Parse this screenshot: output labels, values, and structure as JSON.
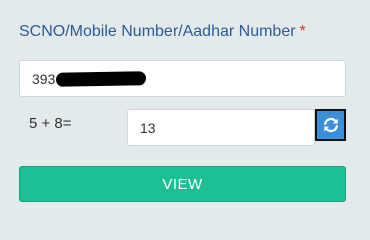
{
  "form": {
    "scno_label": "SCNO/Mobile Number/Aadhar Number",
    "required_mark": "*",
    "scno_value": "393",
    "captcha_question": "5 + 8=",
    "captcha_answer": "13",
    "refresh_icon": "refresh-icon",
    "view_label": "VIEW"
  },
  "colors": {
    "label": "#2f5a99",
    "required": "#e0302b",
    "refresh_button": "#3b8fd9",
    "view_button": "#1dbf95",
    "background": "#e3eaeb"
  }
}
